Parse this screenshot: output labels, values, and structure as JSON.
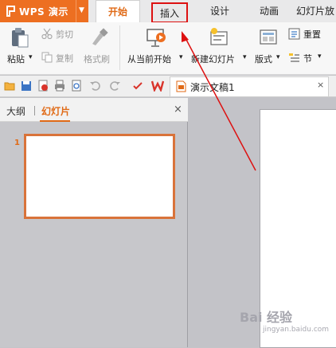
{
  "app": {
    "name": "WPS 演示",
    "dropdown_glyph": "▼"
  },
  "tabs": {
    "home": "开始",
    "insert": "插入",
    "design": "设计",
    "animation": "动画",
    "slideshow": "幻灯片放"
  },
  "ribbon": {
    "paste": "粘贴",
    "cut": "剪切",
    "copy": "复制",
    "format_painter": "格式刷",
    "from_current": "从当前开始",
    "new_slide": "新建幻灯片",
    "layout": "版式",
    "reset": "重置",
    "section": "节",
    "dropdown_glyph": "▾"
  },
  "document": {
    "title": "演示文稿1",
    "close_glyph": "×"
  },
  "panel": {
    "outline_tab": "大纲",
    "slides_tab": "幻灯片",
    "close_glyph": "×",
    "slide_number": "1"
  },
  "watermark": {
    "text": "Bai 经验",
    "sub": "jingyan.baidu.com"
  },
  "colors": {
    "accent": "#ed6f21",
    "highlight_box": "#dd1111",
    "annotation_arrow": "#dd1111"
  },
  "icons": [
    "wps-logo-icon",
    "paste-icon",
    "cut-icon",
    "copy-icon",
    "format-painter-icon",
    "slideshow-from-current-icon",
    "new-slide-icon",
    "layout-icon",
    "reset-icon",
    "section-icon",
    "open-folder-icon",
    "save-icon",
    "export-pdf-icon",
    "print-icon",
    "print-preview-icon",
    "undo-icon",
    "redo-icon",
    "wps-w-icon",
    "document-icon"
  ]
}
